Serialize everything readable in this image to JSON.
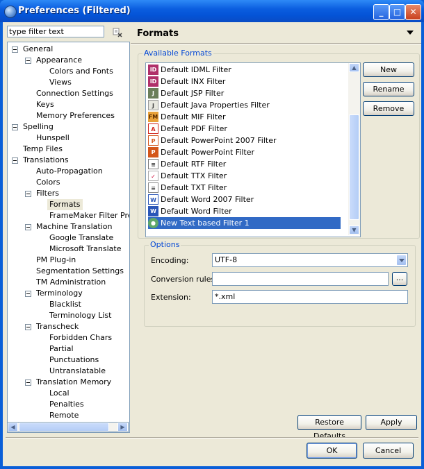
{
  "window": {
    "title": "Preferences (Filtered)"
  },
  "filter": {
    "placeholder": "type filter text",
    "value": "type filter text"
  },
  "tree": {
    "general": "General",
    "appearance": "Appearance",
    "colors_fonts": "Colors and Fonts",
    "views": "Views",
    "connection_settings": "Connection Settings",
    "keys": "Keys",
    "memory_preferences": "Memory Preferences",
    "spelling": "Spelling",
    "hunspell": "Hunspell",
    "temp_files": "Temp Files",
    "translations": "Translations",
    "auto_propagation": "Auto-Propagation",
    "colors": "Colors",
    "filters": "Filters",
    "formats": "Formats",
    "framemaker": "FrameMaker Filter Pref",
    "machine_translation": "Machine Translation",
    "google_translate": "Google Translate",
    "microsoft_translate": "Microsoft Translate",
    "pm_plugin": "PM Plug-in",
    "segmentation": "Segmentation Settings",
    "tm_admin": "TM Administration",
    "terminology": "Terminology",
    "blacklist": "Blacklist",
    "terminology_list": "Terminology List",
    "transcheck": "Transcheck",
    "forbidden_chars": "Forbidden Chars",
    "partial": "Partial",
    "punctuations": "Punctuations",
    "untranslatable": "Untranslatable",
    "translation_memory": "Translation Memory",
    "local": "Local",
    "penalties": "Penalties",
    "remote": "Remote"
  },
  "page": {
    "title": "Formats"
  },
  "formats": {
    "group_label": "Available Formats",
    "items": [
      {
        "label": "Default IDML Filter",
        "icon": "idml-icon"
      },
      {
        "label": "Default INX Filter",
        "icon": "inx-icon"
      },
      {
        "label": "Default JSP Filter",
        "icon": "jsp-icon"
      },
      {
        "label": "Default Java Properties Filter",
        "icon": "java-icon"
      },
      {
        "label": "Default MIF Filter",
        "icon": "mif-icon"
      },
      {
        "label": "Default PDF Filter",
        "icon": "pdf-icon"
      },
      {
        "label": "Default PowerPoint 2007 Filter",
        "icon": "pptx-icon"
      },
      {
        "label": "Default PowerPoint Filter",
        "icon": "ppt-icon"
      },
      {
        "label": "Default RTF Filter",
        "icon": "rtf-icon"
      },
      {
        "label": "Default TTX Filter",
        "icon": "ttx-icon"
      },
      {
        "label": "Default TXT Filter",
        "icon": "txt-icon"
      },
      {
        "label": "Default Word 2007 Filter",
        "icon": "docx-icon"
      },
      {
        "label": "Default Word Filter",
        "icon": "doc-icon"
      },
      {
        "label": "New Text based Filter 1",
        "icon": "text-filter-icon"
      }
    ],
    "new_label": "New",
    "rename_label": "Rename",
    "remove_label": "Remove"
  },
  "options": {
    "group_label": "Options",
    "encoding_label": "Encoding:",
    "encoding_value": "UTF-8",
    "conversion_label": "Conversion rules:",
    "conversion_value": "",
    "browse_label": "...",
    "extension_label": "Extension:",
    "extension_value": "*.xml"
  },
  "buttons": {
    "restore_defaults": "Restore Defaults",
    "apply": "Apply",
    "ok": "OK",
    "cancel": "Cancel"
  }
}
